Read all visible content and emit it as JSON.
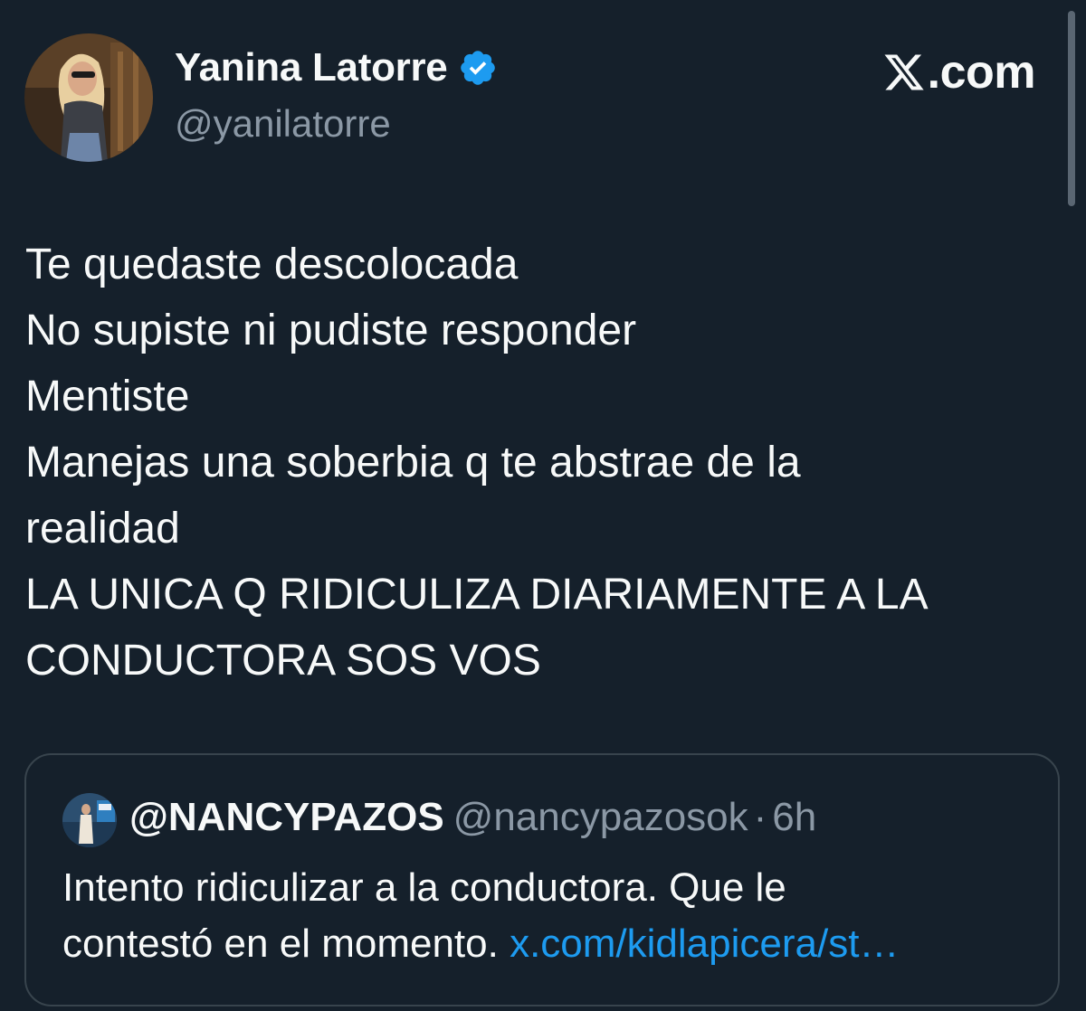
{
  "author": {
    "display_name": "Yanina Latorre",
    "handle": "@yanilatorre",
    "verified": true
  },
  "brand": {
    "label": ".com",
    "icon": "x-logo-icon"
  },
  "tweet": {
    "lines": [
      "Te quedaste descolocada",
      "No supiste ni pudiste responder",
      "Mentiste",
      "Manejas una soberbia q te abstrae de la",
      "realidad",
      "LA UNICA Q RIDICULIZA DIARIAMENTE A LA",
      "CONDUCTORA SOS VOS"
    ]
  },
  "quote": {
    "display_name": "@NANCYPAZOS",
    "handle": "@nancypazosok",
    "separator": "·",
    "time": "6h",
    "line1": "Intento ridiculizar a la conductora. Que le",
    "line2_text": "contestó en el momento. ",
    "link": "x.com/kidlapicera/st…"
  },
  "colors": {
    "background": "#15202b",
    "text": "#f7f9f9",
    "muted": "#8b98a5",
    "link": "#1d9bf0",
    "verified": "#1d9bf0",
    "border": "#38444d"
  }
}
